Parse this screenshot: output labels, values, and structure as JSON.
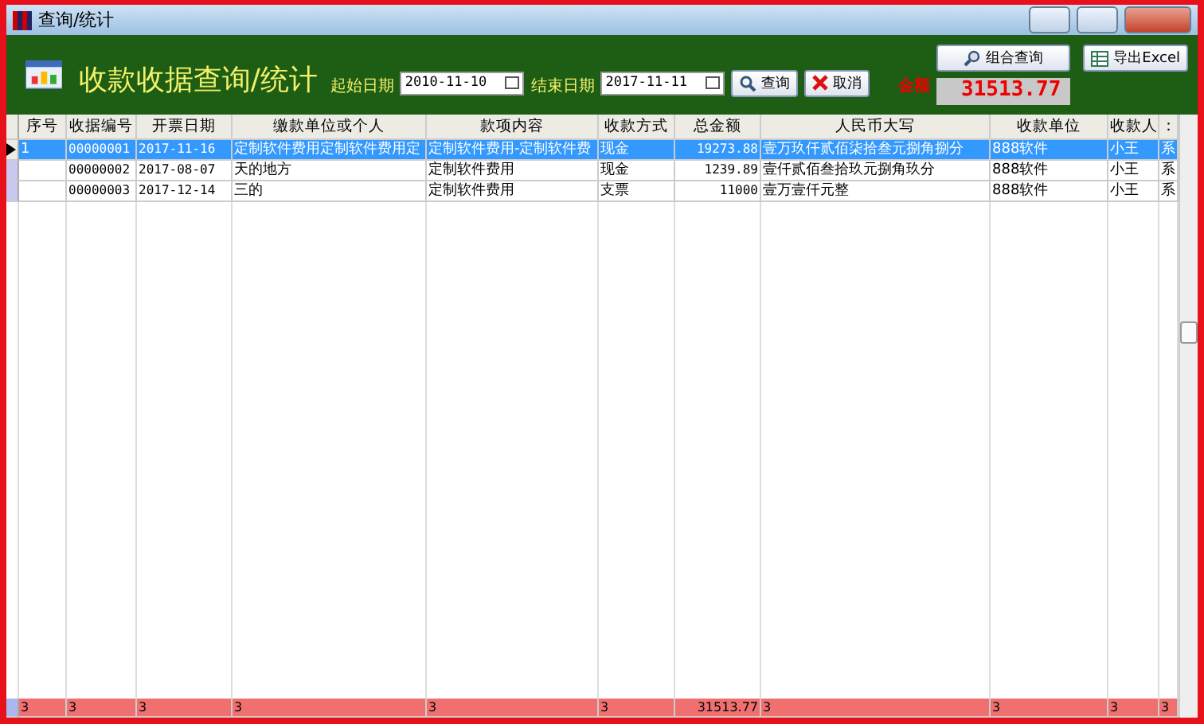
{
  "window": {
    "title": "查询/统计"
  },
  "header": {
    "title": "收款收据查询/统计",
    "start_label": "起始日期",
    "start_date": "2010-11-10",
    "end_label": "结束日期",
    "end_date": "2017-11-11",
    "query_button": "查询",
    "cancel_button": "取消",
    "amount_label": "金额",
    "amount": "31513.77",
    "combo_button": "组合查询",
    "export_button": "导出Excel"
  },
  "table": {
    "columns": [
      "序号",
      "收据编号",
      "开票日期",
      "缴款单位或个人",
      "款项内容",
      "收款方式",
      "总金额",
      "人民币大写",
      "收款单位",
      "收款人",
      "："
    ],
    "rows": [
      {
        "selected": true,
        "cells": [
          "1",
          "00000001",
          "2017-11-16",
          "定制软件费用定制软件费用定",
          "定制软件费用-定制软件费",
          "现金",
          "19273.88",
          "壹万玖仟贰佰柒拾叁元捌角捌分",
          "888软件",
          "小王",
          "系"
        ]
      },
      {
        "selected": false,
        "cells": [
          "",
          "00000002",
          "2017-08-07",
          "天的地方",
          "定制软件费用",
          "现金",
          "1239.89",
          "壹仟贰佰叁拾玖元捌角玖分",
          "888软件",
          "小王",
          "系"
        ]
      },
      {
        "selected": false,
        "cells": [
          "",
          "00000003",
          "2017-12-14",
          "三的",
          "定制软件费用",
          "支票",
          "11000",
          "壹万壹仟元整",
          "888软件",
          "小王",
          "系"
        ]
      }
    ],
    "totals": [
      "3",
      "3",
      "3",
      "3",
      "3",
      "3",
      "31513.77",
      "3",
      "3",
      "3",
      "3"
    ]
  }
}
